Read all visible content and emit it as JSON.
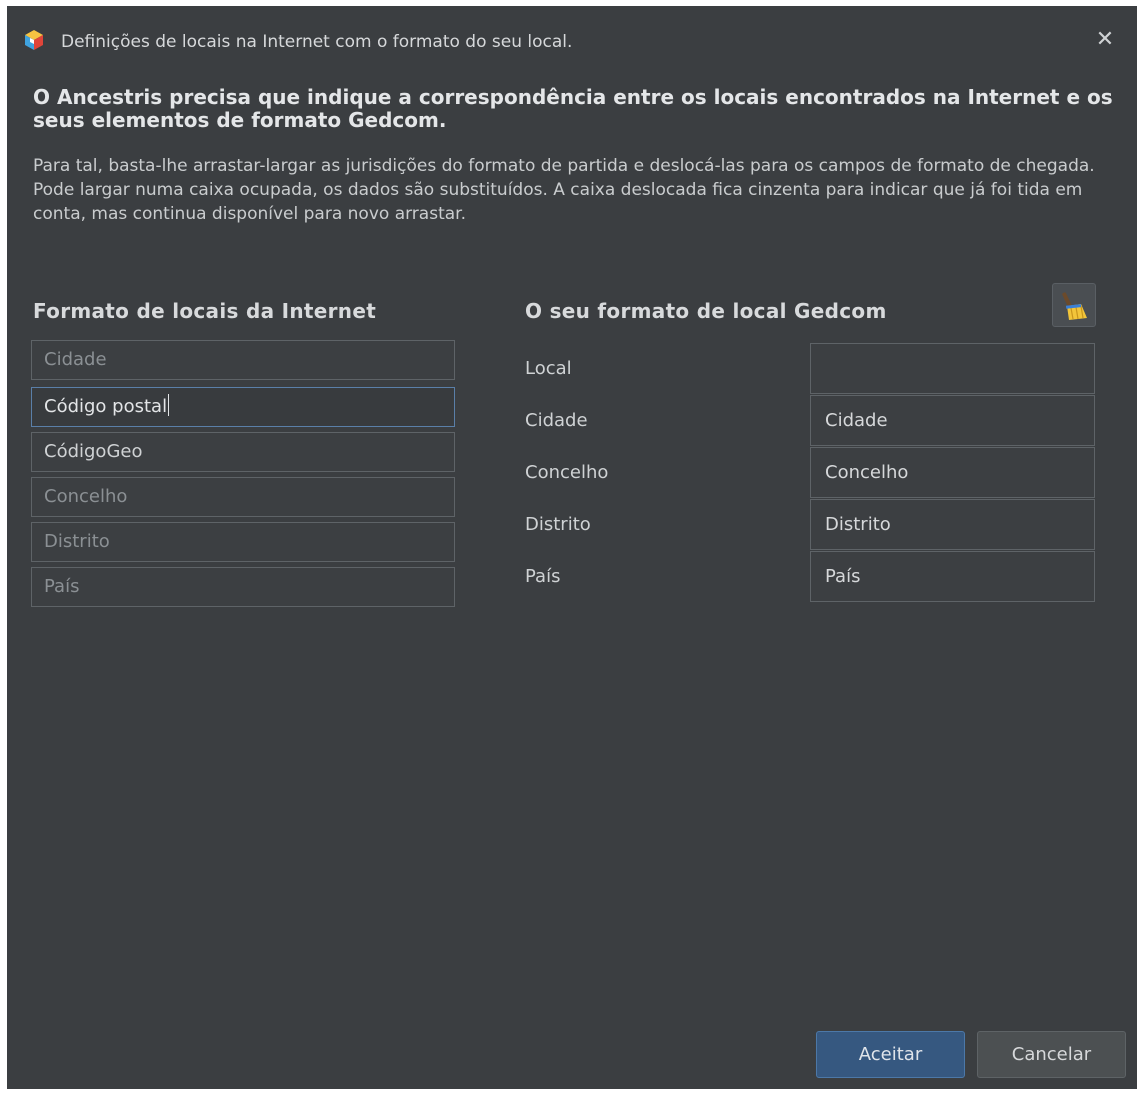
{
  "window": {
    "title": "Definições de locais na Internet com o formato do seu local.",
    "close_icon": "close-icon"
  },
  "headline": "O Ancestris precisa que indique a correspondência entre os locais encontrados na Internet e os seus elementos de formato Gedcom.",
  "description": "Para tal, basta-lhe arrastar-largar as jurisdições do formato de partida e deslocá-las para os campos de formato de chegada. Pode largar numa caixa ocupada, os dados são substituídos. A caixa deslocada fica cinzenta para indicar que já foi tida em conta, mas continua disponível para novo arrastar.",
  "source": {
    "title": "Formato de locais da Internet",
    "items": [
      {
        "label": "Cidade",
        "state": "used"
      },
      {
        "label": "Código postal",
        "state": "active"
      },
      {
        "label": "CódigoGeo",
        "state": "available"
      },
      {
        "label": "Concelho",
        "state": "used"
      },
      {
        "label": "Distrito",
        "state": "used"
      },
      {
        "label": "País",
        "state": "used"
      }
    ]
  },
  "target": {
    "title": "O seu formato de local Gedcom",
    "clear_icon": "broom-icon",
    "rows": [
      {
        "label": "Local",
        "value": ""
      },
      {
        "label": "Cidade",
        "value": "Cidade"
      },
      {
        "label": "Concelho",
        "value": "Concelho"
      },
      {
        "label": "Distrito",
        "value": "Distrito"
      },
      {
        "label": "País",
        "value": "País"
      }
    ]
  },
  "buttons": {
    "accept": "Aceitar",
    "cancel": "Cancelar"
  },
  "colors": {
    "background": "#3b3e41",
    "accent": "#365880",
    "used_text": "#8b9094"
  }
}
